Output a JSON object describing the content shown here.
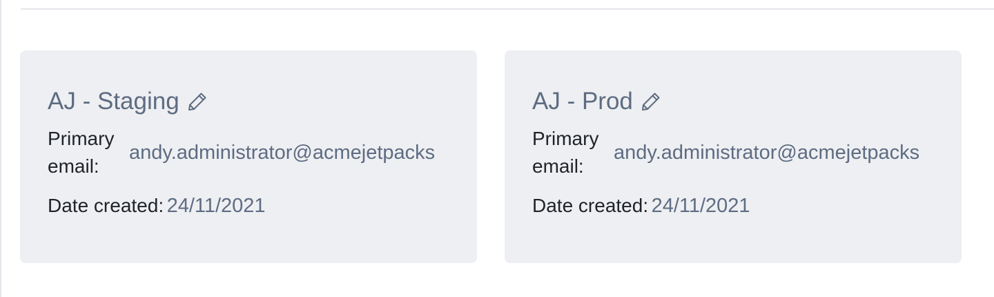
{
  "accounts": [
    {
      "name": "AJ - Staging",
      "edit_icon": "pencil-icon",
      "email_label": "Primary email:",
      "email": "andy.administrator@acmejetpacks",
      "date_label": "Date created:",
      "date": "24/11/2021"
    },
    {
      "name": "AJ - Prod",
      "edit_icon": "pencil-icon",
      "email_label": "Primary email:",
      "email": "andy.administrator@acmejetpacks",
      "date_label": "Date created:",
      "date": "24/11/2021"
    }
  ],
  "colors": {
    "card_background": "#eeeff2",
    "muted_text": "#5d6c82",
    "label_text": "#1f2328",
    "divider": "#e3e6ea"
  }
}
